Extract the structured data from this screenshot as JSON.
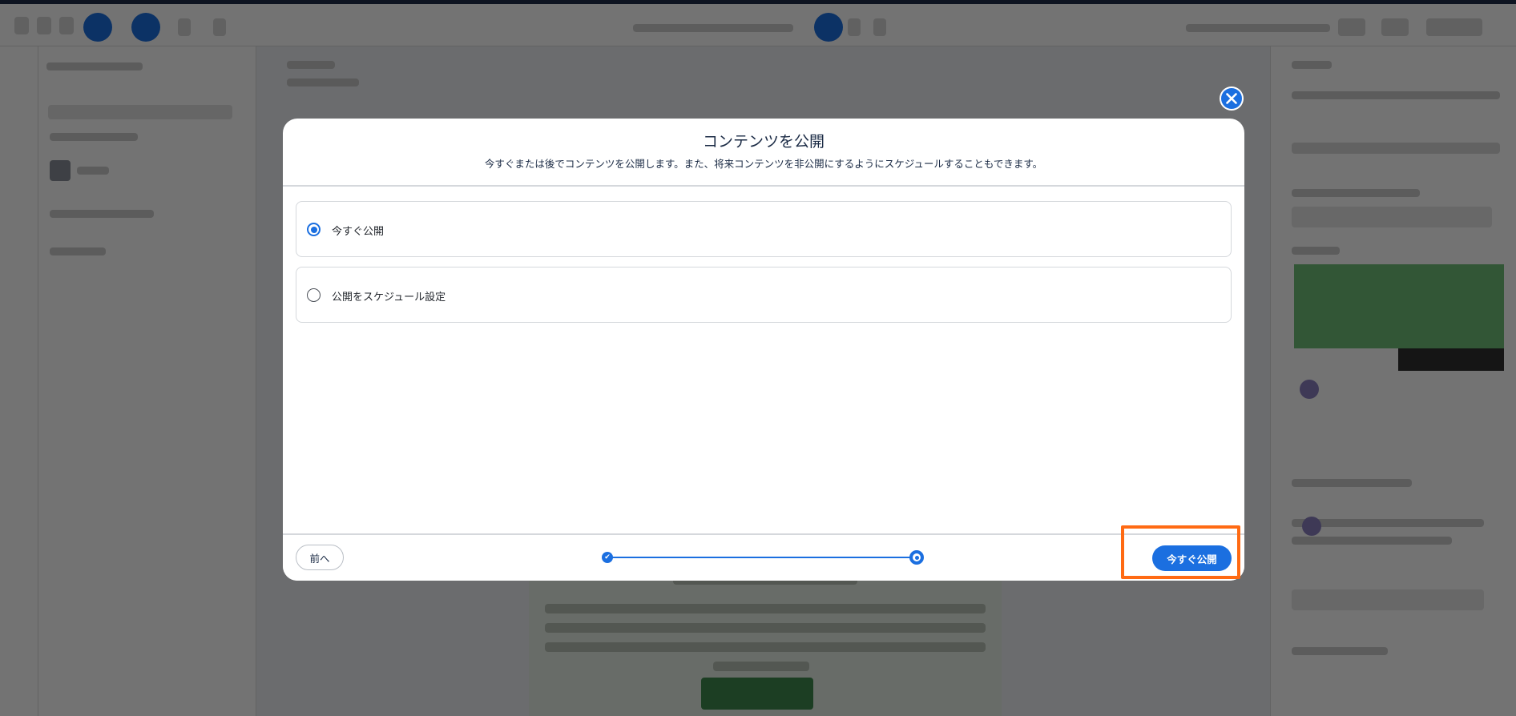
{
  "modal": {
    "title": "コンテンツを公開",
    "subtitle": "今すぐまたは後でコンテンツを公開します。また、将来コンテンツを非公開にするようにスケジュールすることもできます。",
    "options": [
      {
        "label": "今すぐ公開",
        "selected": true
      },
      {
        "label": "公開をスケジュール設定",
        "selected": false
      }
    ],
    "footer": {
      "prev_label": "前へ",
      "publish_label": "今すぐ公開"
    }
  },
  "icons": {
    "close": "close-icon",
    "step_done": "check-icon"
  },
  "colors": {
    "accent": "#1b6fe0",
    "highlight": "#ff6a13",
    "title_text": "#1b2b45"
  }
}
